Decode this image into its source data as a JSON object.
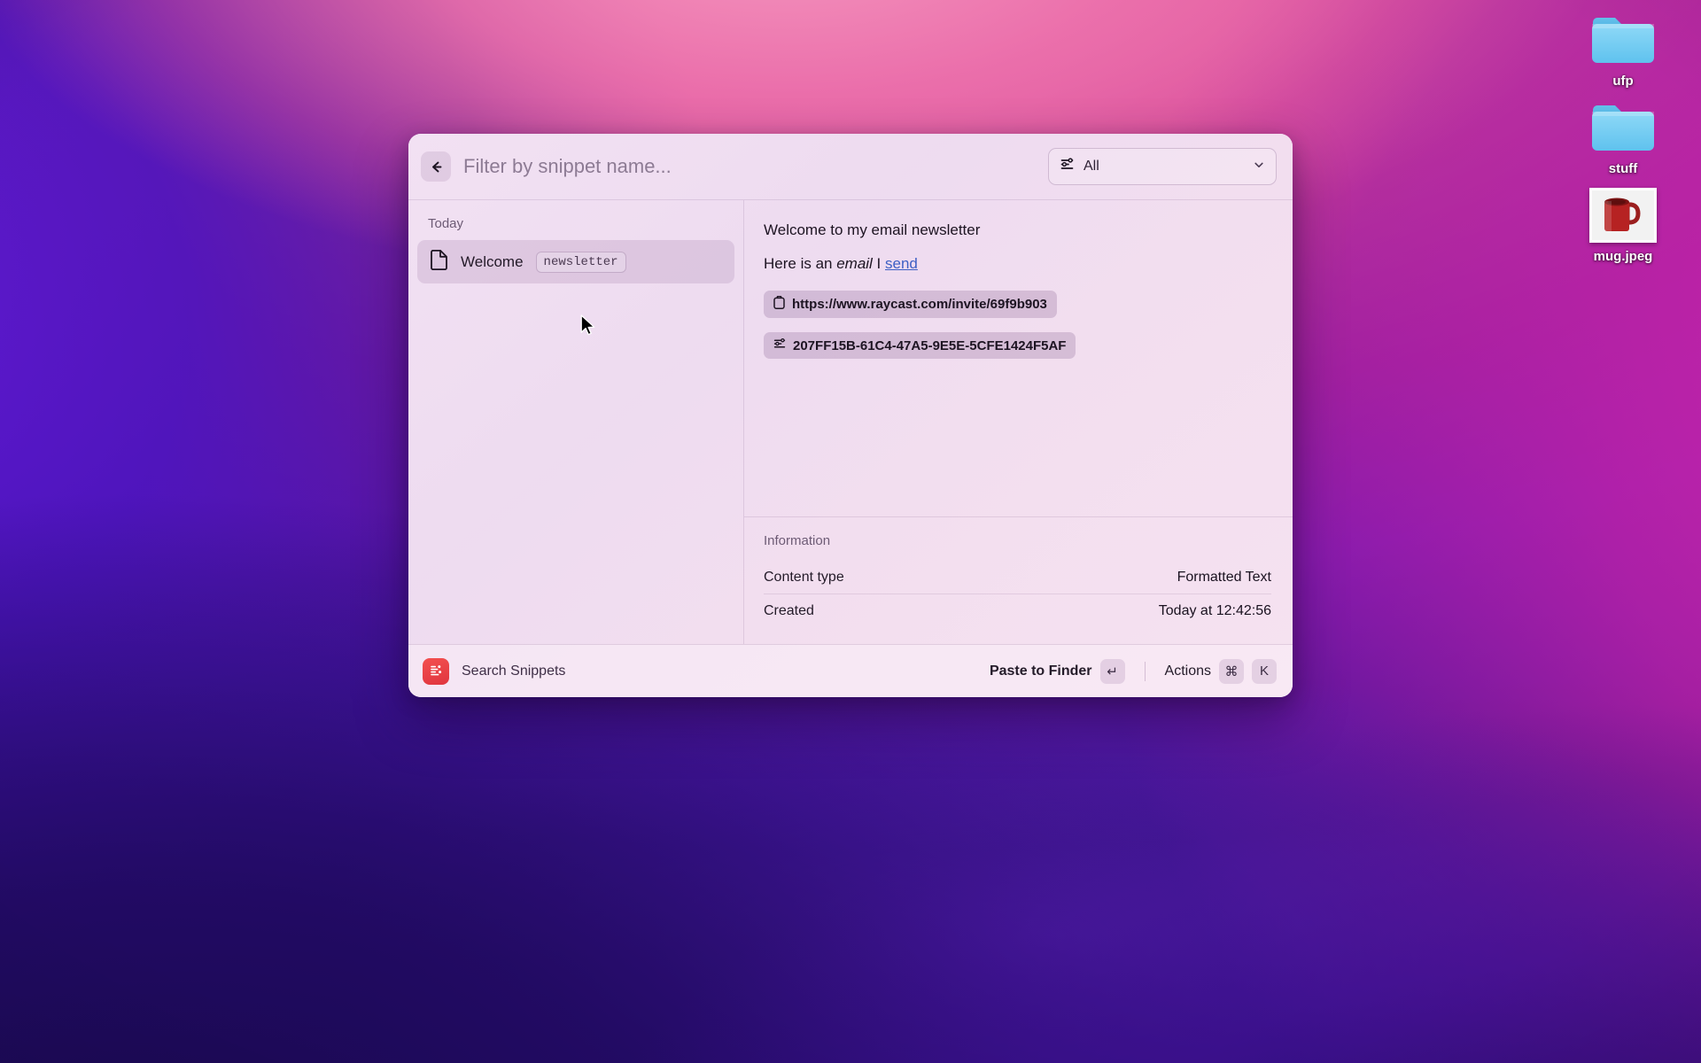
{
  "desktop": {
    "icons": [
      {
        "name": "ufp",
        "type": "folder"
      },
      {
        "name": "stuff",
        "type": "folder"
      },
      {
        "name": "mug.jpeg",
        "type": "image"
      }
    ]
  },
  "window": {
    "app": "Raycast",
    "search": {
      "placeholder": "Filter by snippet name...",
      "value": ""
    },
    "back_button_icon": "arrow-left-icon",
    "type_filter": {
      "label": "All",
      "icon": "filter-list-icon",
      "chevron": "chevron-down-icon",
      "options": [
        "All"
      ]
    },
    "sidebar": {
      "section": "Today",
      "items": [
        {
          "title": "Welcome",
          "keyword": "newsletter",
          "icon": "document-icon",
          "selected": true
        }
      ]
    },
    "detail": {
      "preview": {
        "title": "Welcome to my email newsletter",
        "line_prefix": "Here is an ",
        "line_emphasis": "email",
        "line_middle": " I ",
        "line_link": "send",
        "tokens": [
          {
            "icon": "clipboard-icon",
            "text": "https://www.raycast.com/invite/69f9b903"
          },
          {
            "icon": "uuid-icon",
            "text": "207FF15B-61C4-47A5-9E5E-5CFE1424F5AF"
          }
        ]
      },
      "information": {
        "heading": "Information",
        "rows": [
          {
            "label": "Content type",
            "value": "Formatted Text"
          },
          {
            "label": "Created",
            "value": "Today at 12:42:56"
          }
        ]
      }
    },
    "footer": {
      "app_icon": "raycast-snippets-icon",
      "title": "Search Snippets",
      "primary_action": {
        "label": "Paste to Finder",
        "key": "↵"
      },
      "secondary_action": {
        "label": "Actions",
        "key_modifier": "⌘",
        "key_letter": "K"
      }
    }
  },
  "colors": {
    "accent_link": "#3d5fc4",
    "raycast_red": "#e0353f",
    "folder_blue": "#6fcbf2",
    "window_bg": "#ece2f0"
  }
}
